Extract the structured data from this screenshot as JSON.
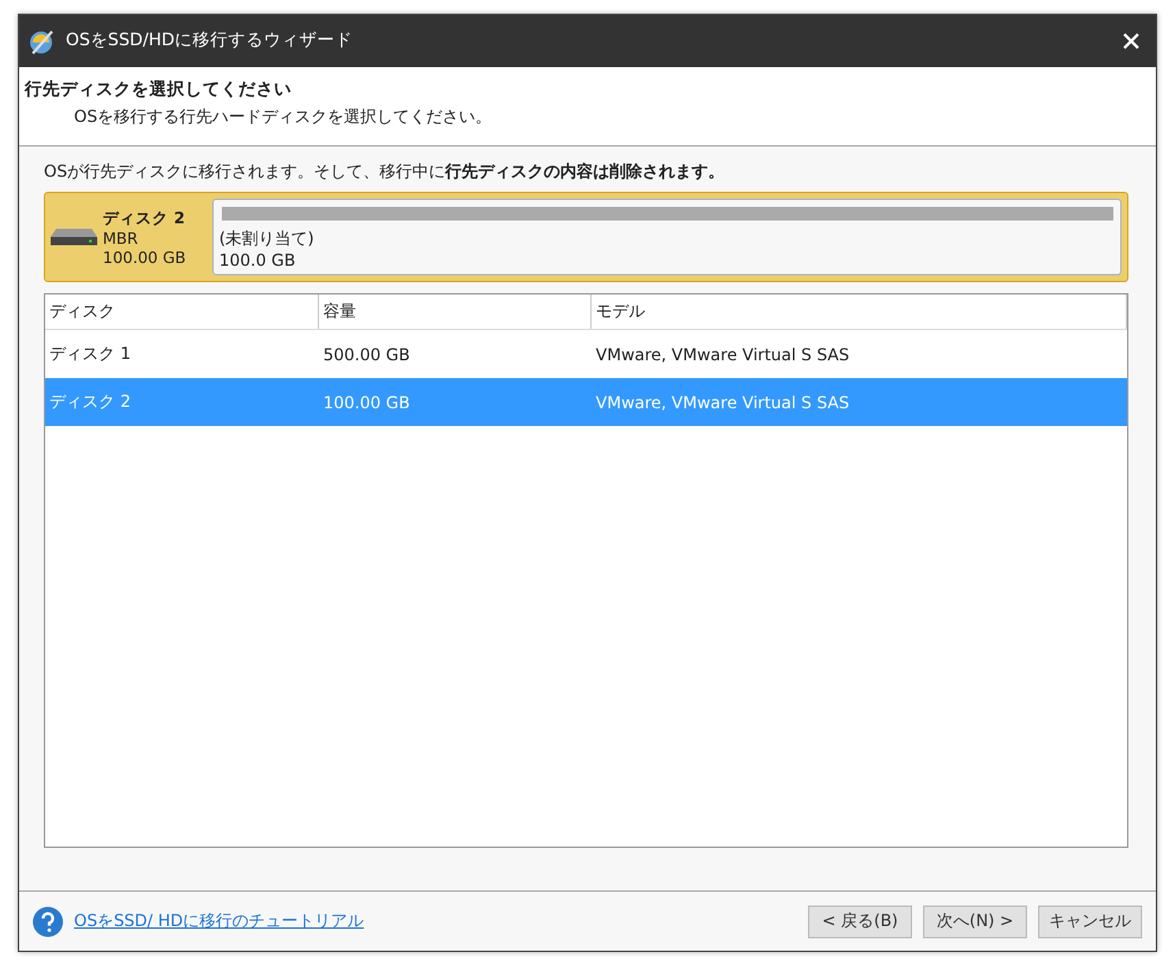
{
  "window": {
    "title": "OSをSSD/HDに移行するウィザード"
  },
  "header": {
    "title": "行先ディスクを選択してください",
    "subtitle": "OSを移行する行先ハードディスクを選択してください。"
  },
  "warning": "OSが行先ディスクに移行されます。そして、移行中に**行先ディスクの内容は削除されます。**",
  "disk_map": {
    "name": "ディスク 2",
    "type": "MBR",
    "size": "100.00 GB",
    "selected": true,
    "partition": {
      "label": "(未割り当て)",
      "size": "100.0 GB"
    }
  },
  "table": {
    "columns": [
      "ディスク",
      "容量",
      "モデル"
    ],
    "rows": [
      {
        "cells": [
          "ディスク 1",
          "500.00 GB",
          "VMware, VMware Virtual S SAS"
        ],
        "selected": false
      },
      {
        "cells": [
          "ディスク 2",
          "100.00 GB",
          "VMware, VMware Virtual S SAS"
        ],
        "selected": true
      }
    ]
  },
  "footer": {
    "help_link": "OSをSSD/ HDに移行のチュートリアル",
    "buttons": [
      "< 戻る(B)",
      "次へ(N) >",
      "キャンセル"
    ]
  }
}
